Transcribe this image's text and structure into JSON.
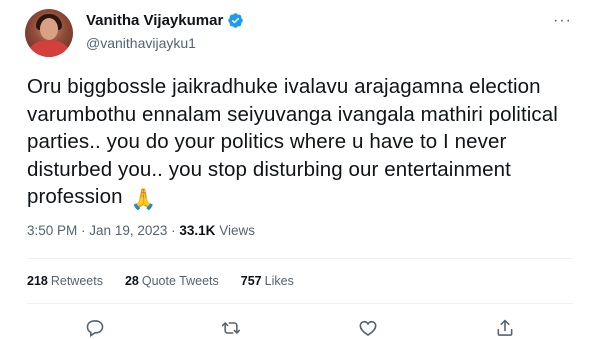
{
  "user": {
    "display_name": "Vanitha Vijaykumar",
    "handle": "@vanithavijayku1",
    "verified_icon": "verified-badge-icon",
    "verified_color": "#1d9bf0"
  },
  "more_label": "···",
  "tweet": {
    "text": "Oru biggbossle jaikradhuke ivalavu arajagamna election varumbothu ennalam seiyuvanga ivangala mathiri political parties.. you do your politics where u have to I never disturbed you.. you stop disturbing our entertainment profession",
    "emoji": "🙏"
  },
  "meta": {
    "time": "3:50 PM",
    "date": "Jan 19, 2023",
    "views_count": "33.1K",
    "views_label": "Views"
  },
  "stats": {
    "retweets_count": "218",
    "retweets_label": "Retweets",
    "quotes_count": "28",
    "quotes_label": "Quote Tweets",
    "likes_count": "757",
    "likes_label": "Likes"
  },
  "actions": {
    "reply_icon": "reply-icon",
    "retweet_icon": "retweet-icon",
    "like_icon": "like-icon",
    "share_icon": "share-icon"
  },
  "colors": {
    "text": "#0f1419",
    "secondary": "#536471",
    "divider": "#eff3f4"
  }
}
